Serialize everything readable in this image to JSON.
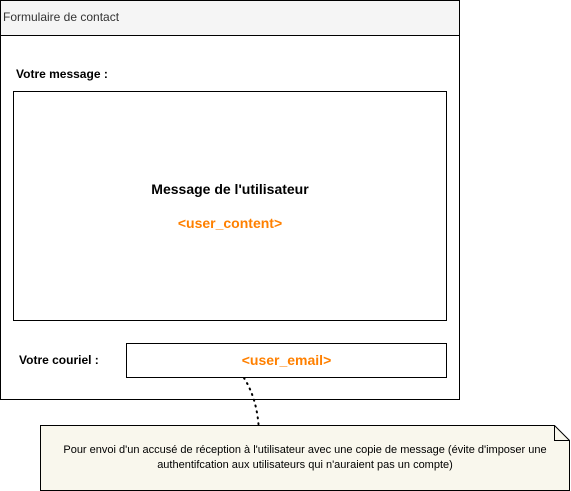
{
  "form": {
    "title": "Formulaire de contact",
    "message_label": "Votre message :",
    "message_title": "Message de l'utilisateur",
    "message_placeholder": "<user_content>",
    "email_label": "Votre couriel :",
    "email_placeholder": "<user_email>"
  },
  "note": {
    "text": "Pour envoi d'un accusé de réception à l'utilisateur avec une copie de message (évite d'imposer une authentifcation aux utilisateurs qui n'auraient pas un compte)"
  },
  "colors": {
    "placeholder": "#ff8000",
    "header_bg": "#f5f5f5",
    "note_bg": "#f9f7ed"
  }
}
